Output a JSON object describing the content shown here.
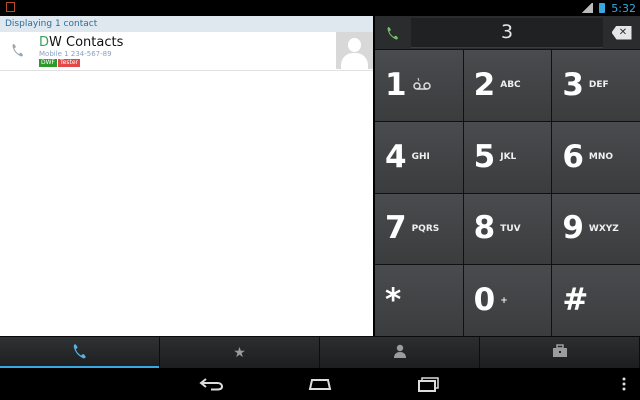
{
  "status_bar": {
    "time": "5:32",
    "icons": [
      "notification-icon",
      "signal-icon",
      "battery-icon"
    ]
  },
  "contacts": {
    "header": "Displaying 1 contact",
    "items": [
      {
        "name_first_letter": "D",
        "name_rest": "W Contacts",
        "phone": "Mobile 1 234-567-89",
        "tags": [
          "DWF",
          "Tester"
        ]
      }
    ]
  },
  "dialer": {
    "digits": "3",
    "keys": [
      {
        "num": "1",
        "letters": ""
      },
      {
        "num": "2",
        "letters": "ABC"
      },
      {
        "num": "3",
        "letters": "DEF"
      },
      {
        "num": "4",
        "letters": "GHI"
      },
      {
        "num": "5",
        "letters": "JKL"
      },
      {
        "num": "6",
        "letters": "MNO"
      },
      {
        "num": "7",
        "letters": "PQRS"
      },
      {
        "num": "8",
        "letters": "TUV"
      },
      {
        "num": "9",
        "letters": "WXYZ"
      },
      {
        "num": "*",
        "letters": ""
      },
      {
        "num": "0",
        "letters": "+"
      },
      {
        "num": "#",
        "letters": ""
      }
    ]
  },
  "tabs": {
    "items": [
      {
        "name": "phone",
        "icon": "phone-icon",
        "active": true
      },
      {
        "name": "favorites",
        "icon": "star-icon",
        "active": false
      },
      {
        "name": "contacts",
        "icon": "person-icon",
        "active": false
      },
      {
        "name": "groups",
        "icon": "briefcase-icon",
        "active": false
      }
    ]
  },
  "colors": {
    "accent": "#3aa8e0",
    "call_green": "#74c16a",
    "tag_dwf": "#2b9b2b",
    "tag_tester": "#e54848"
  }
}
